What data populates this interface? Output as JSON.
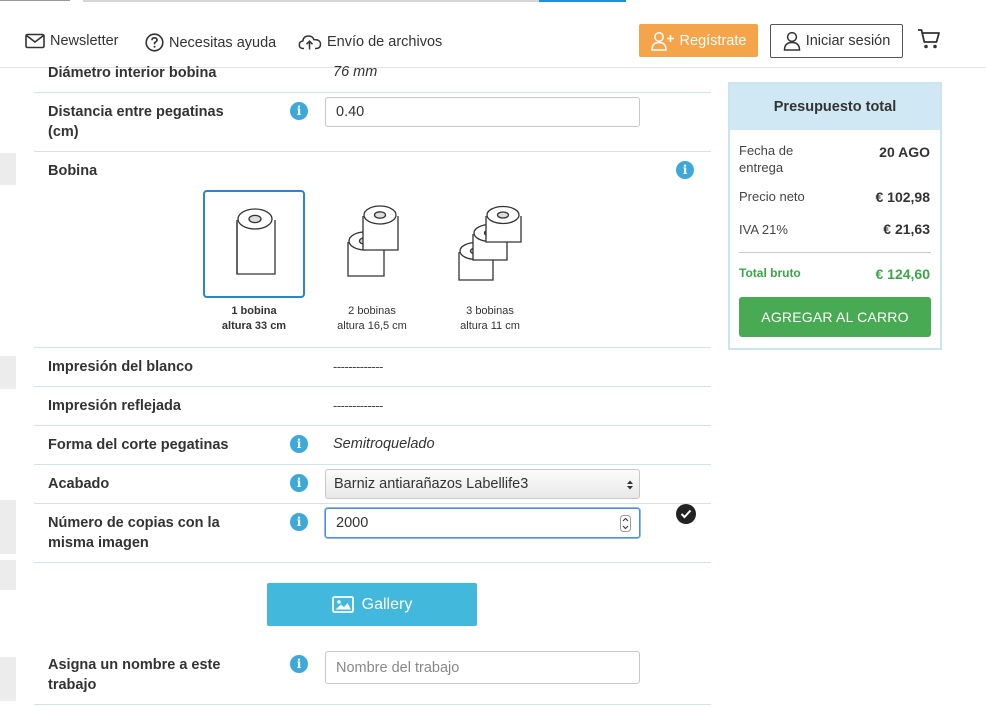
{
  "header": {
    "newsletter": "Newsletter",
    "help": "Necesitas ayuda",
    "upload": "Envío de archivos",
    "register": "Regístrate",
    "login": "Iniciar sesión"
  },
  "form": {
    "diametro": {
      "label": "Diámetro interior bobina",
      "value": "76 mm"
    },
    "distancia": {
      "label": "Distancia entre pegatinas (cm)",
      "value": "0.40"
    },
    "bobina": {
      "label": "Bobina",
      "options": [
        {
          "line1": "1 bobina",
          "line2": "altura 33 cm",
          "selected": true
        },
        {
          "line1": "2 bobinas",
          "line2": "altura 16,5 cm",
          "selected": false
        },
        {
          "line1": "3 bobinas",
          "line2": "altura 11 cm",
          "selected": false
        }
      ]
    },
    "blanco": {
      "label": "Impresión del blanco",
      "value": "-------------"
    },
    "reflejada": {
      "label": "Impresión reflejada",
      "value": "-------------"
    },
    "corte": {
      "label": "Forma del corte pegatinas",
      "value": "Semitroquelado"
    },
    "acabado": {
      "label": "Acabado",
      "value": "Barniz antiarañazos Labellife3"
    },
    "copias": {
      "label": "Número de copias con la misma imagen",
      "value": "2000"
    },
    "gallery": "Gallery",
    "nombre": {
      "label": "Asigna un nombre a este trabajo",
      "placeholder": "Nombre del trabajo"
    }
  },
  "summary": {
    "title": "Presupuesto total",
    "fecha_label": "Fecha de entrega",
    "fecha_value": "20 AGO",
    "neto_label": "Precio neto",
    "neto_value": "€ 102,98",
    "iva_label": "IVA 21%",
    "iva_value": "€ 21,63",
    "total_label": "Total bruto",
    "total_value": "€ 124,60",
    "add_button": "AGREGAR AL CARRO"
  },
  "colors": {
    "accent_blue": "#3da9d9",
    "register_orange": "#f5a44a",
    "cart_green": "#48aa52",
    "total_green": "#3aa648"
  }
}
